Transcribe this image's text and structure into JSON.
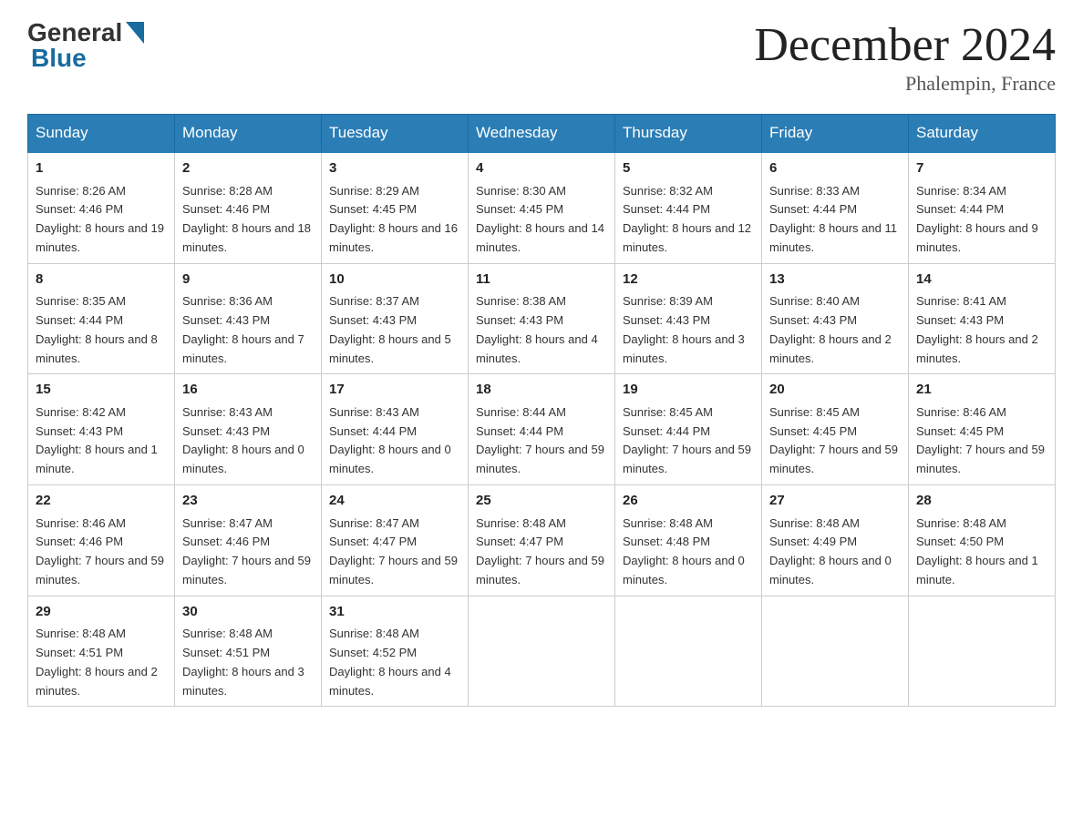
{
  "header": {
    "logo_general": "General",
    "logo_blue": "Blue",
    "month_title": "December 2024",
    "location": "Phalempin, France"
  },
  "days_of_week": [
    "Sunday",
    "Monday",
    "Tuesday",
    "Wednesday",
    "Thursday",
    "Friday",
    "Saturday"
  ],
  "weeks": [
    [
      {
        "day": "1",
        "sunrise": "8:26 AM",
        "sunset": "4:46 PM",
        "daylight": "8 hours and 19 minutes."
      },
      {
        "day": "2",
        "sunrise": "8:28 AM",
        "sunset": "4:46 PM",
        "daylight": "8 hours and 18 minutes."
      },
      {
        "day": "3",
        "sunrise": "8:29 AM",
        "sunset": "4:45 PM",
        "daylight": "8 hours and 16 minutes."
      },
      {
        "day": "4",
        "sunrise": "8:30 AM",
        "sunset": "4:45 PM",
        "daylight": "8 hours and 14 minutes."
      },
      {
        "day": "5",
        "sunrise": "8:32 AM",
        "sunset": "4:44 PM",
        "daylight": "8 hours and 12 minutes."
      },
      {
        "day": "6",
        "sunrise": "8:33 AM",
        "sunset": "4:44 PM",
        "daylight": "8 hours and 11 minutes."
      },
      {
        "day": "7",
        "sunrise": "8:34 AM",
        "sunset": "4:44 PM",
        "daylight": "8 hours and 9 minutes."
      }
    ],
    [
      {
        "day": "8",
        "sunrise": "8:35 AM",
        "sunset": "4:44 PM",
        "daylight": "8 hours and 8 minutes."
      },
      {
        "day": "9",
        "sunrise": "8:36 AM",
        "sunset": "4:43 PM",
        "daylight": "8 hours and 7 minutes."
      },
      {
        "day": "10",
        "sunrise": "8:37 AM",
        "sunset": "4:43 PM",
        "daylight": "8 hours and 5 minutes."
      },
      {
        "day": "11",
        "sunrise": "8:38 AM",
        "sunset": "4:43 PM",
        "daylight": "8 hours and 4 minutes."
      },
      {
        "day": "12",
        "sunrise": "8:39 AM",
        "sunset": "4:43 PM",
        "daylight": "8 hours and 3 minutes."
      },
      {
        "day": "13",
        "sunrise": "8:40 AM",
        "sunset": "4:43 PM",
        "daylight": "8 hours and 2 minutes."
      },
      {
        "day": "14",
        "sunrise": "8:41 AM",
        "sunset": "4:43 PM",
        "daylight": "8 hours and 2 minutes."
      }
    ],
    [
      {
        "day": "15",
        "sunrise": "8:42 AM",
        "sunset": "4:43 PM",
        "daylight": "8 hours and 1 minute."
      },
      {
        "day": "16",
        "sunrise": "8:43 AM",
        "sunset": "4:43 PM",
        "daylight": "8 hours and 0 minutes."
      },
      {
        "day": "17",
        "sunrise": "8:43 AM",
        "sunset": "4:44 PM",
        "daylight": "8 hours and 0 minutes."
      },
      {
        "day": "18",
        "sunrise": "8:44 AM",
        "sunset": "4:44 PM",
        "daylight": "7 hours and 59 minutes."
      },
      {
        "day": "19",
        "sunrise": "8:45 AM",
        "sunset": "4:44 PM",
        "daylight": "7 hours and 59 minutes."
      },
      {
        "day": "20",
        "sunrise": "8:45 AM",
        "sunset": "4:45 PM",
        "daylight": "7 hours and 59 minutes."
      },
      {
        "day": "21",
        "sunrise": "8:46 AM",
        "sunset": "4:45 PM",
        "daylight": "7 hours and 59 minutes."
      }
    ],
    [
      {
        "day": "22",
        "sunrise": "8:46 AM",
        "sunset": "4:46 PM",
        "daylight": "7 hours and 59 minutes."
      },
      {
        "day": "23",
        "sunrise": "8:47 AM",
        "sunset": "4:46 PM",
        "daylight": "7 hours and 59 minutes."
      },
      {
        "day": "24",
        "sunrise": "8:47 AM",
        "sunset": "4:47 PM",
        "daylight": "7 hours and 59 minutes."
      },
      {
        "day": "25",
        "sunrise": "8:48 AM",
        "sunset": "4:47 PM",
        "daylight": "7 hours and 59 minutes."
      },
      {
        "day": "26",
        "sunrise": "8:48 AM",
        "sunset": "4:48 PM",
        "daylight": "8 hours and 0 minutes."
      },
      {
        "day": "27",
        "sunrise": "8:48 AM",
        "sunset": "4:49 PM",
        "daylight": "8 hours and 0 minutes."
      },
      {
        "day": "28",
        "sunrise": "8:48 AM",
        "sunset": "4:50 PM",
        "daylight": "8 hours and 1 minute."
      }
    ],
    [
      {
        "day": "29",
        "sunrise": "8:48 AM",
        "sunset": "4:51 PM",
        "daylight": "8 hours and 2 minutes."
      },
      {
        "day": "30",
        "sunrise": "8:48 AM",
        "sunset": "4:51 PM",
        "daylight": "8 hours and 3 minutes."
      },
      {
        "day": "31",
        "sunrise": "8:48 AM",
        "sunset": "4:52 PM",
        "daylight": "8 hours and 4 minutes."
      },
      null,
      null,
      null,
      null
    ]
  ]
}
